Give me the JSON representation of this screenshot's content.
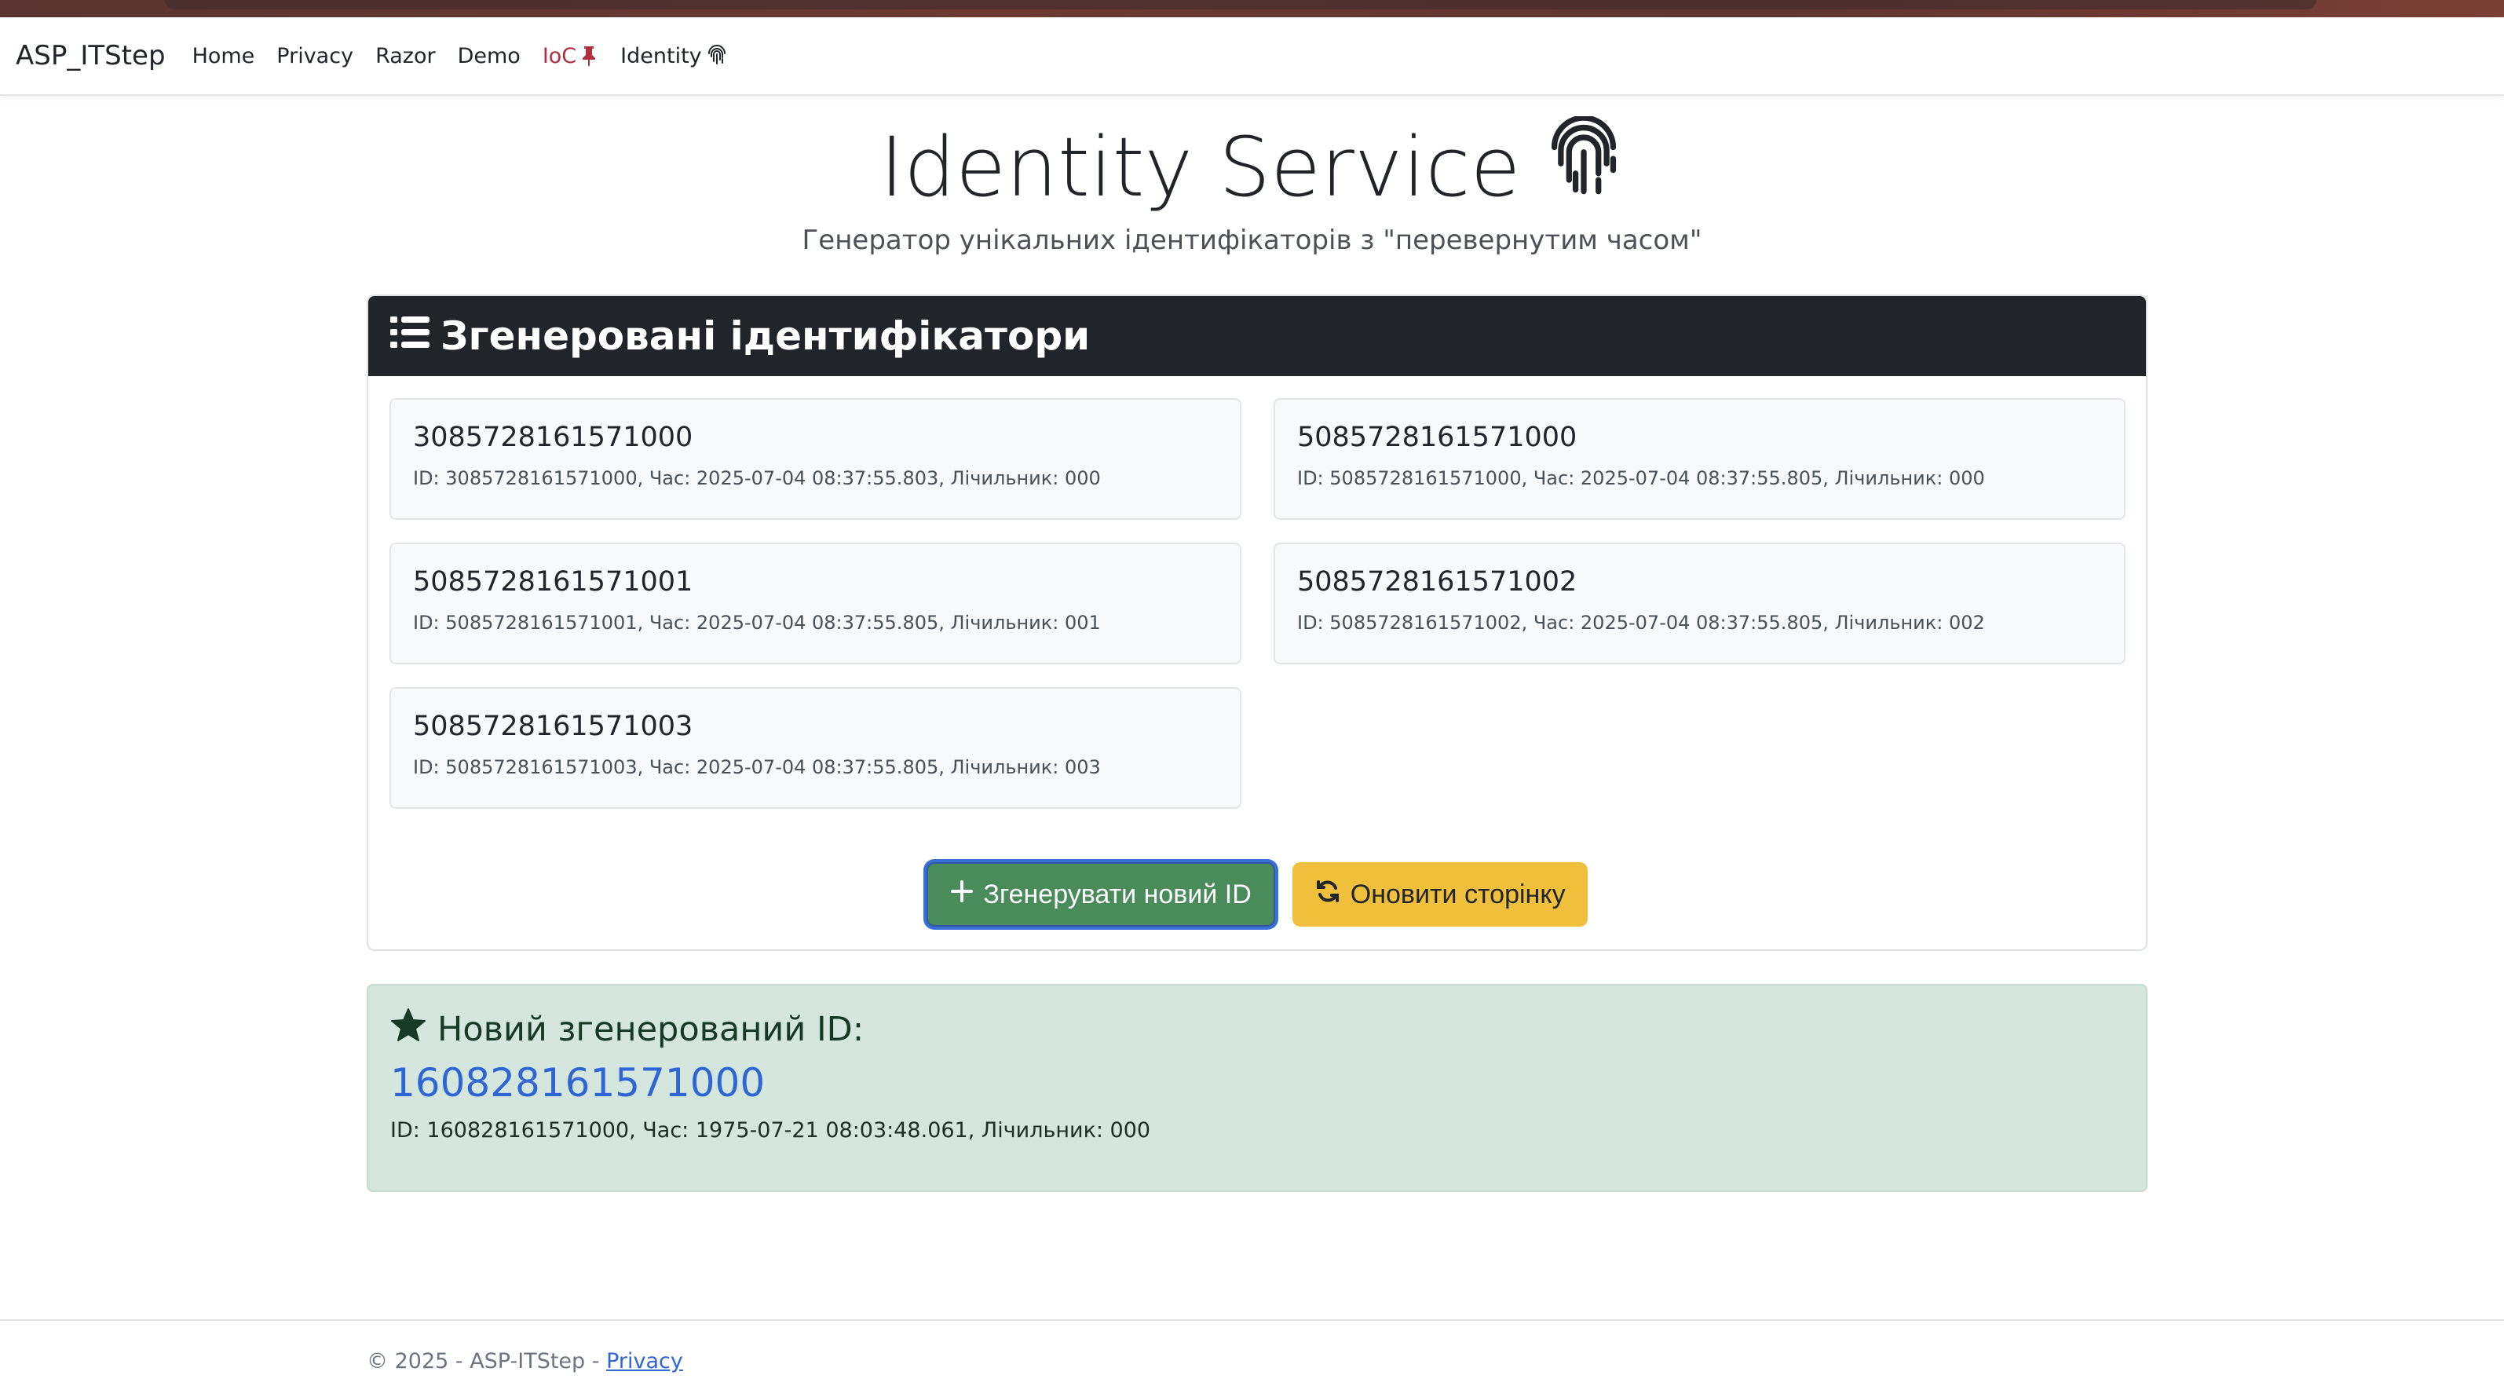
{
  "navbar": {
    "brand": "ASP_ITStep",
    "links": [
      {
        "label": "Home"
      },
      {
        "label": "Privacy"
      },
      {
        "label": "Razor"
      },
      {
        "label": "Demo"
      },
      {
        "label": "IoC",
        "icon": "pin-icon",
        "active": true
      },
      {
        "label": "Identity",
        "icon": "fingerprint-icon"
      }
    ]
  },
  "header": {
    "title": "Identity Service",
    "title_icon": "fingerprint-icon",
    "subtitle": "Генератор унікальних ідентифікаторів з \"перевернутим часом\""
  },
  "card": {
    "title": "Згенеровані ідентифікатори",
    "title_icon": "list-icon",
    "ids": [
      {
        "value": "3085728161571000",
        "meta": "ID: 3085728161571000, Час: 2025-07-04 08:37:55.803, Лічильник: 000"
      },
      {
        "value": "5085728161571000",
        "meta": "ID: 5085728161571000, Час: 2025-07-04 08:37:55.805, Лічильник: 000"
      },
      {
        "value": "5085728161571001",
        "meta": "ID: 5085728161571001, Час: 2025-07-04 08:37:55.805, Лічильник: 001"
      },
      {
        "value": "5085728161571002",
        "meta": "ID: 5085728161571002, Час: 2025-07-04 08:37:55.805, Лічильник: 002"
      },
      {
        "value": "5085728161571003",
        "meta": "ID: 5085728161571003, Час: 2025-07-04 08:37:55.805, Лічильник: 003"
      }
    ],
    "buttons": {
      "generate": {
        "label": "Згенерувати новий ID",
        "icon": "plus-icon"
      },
      "refresh": {
        "label": "Оновити сторінку",
        "icon": "refresh-icon"
      }
    }
  },
  "alert": {
    "title": "Новий згенерований ID:",
    "icon": "star-icon",
    "id_value": "160828161571000",
    "meta": "ID: 160828161571000, Час: 1975-07-21 08:03:48.061, Лічильник: 000"
  },
  "footer": {
    "copyright": "© 2025 - ASP-ITStep - ",
    "privacy_link": "Privacy"
  },
  "colors": {
    "card_header_bg": "#212529",
    "success_button": "#4a8b5c",
    "warning_button": "#f0c03c",
    "alert_bg": "#d4e6dd",
    "link_blue": "#2f66d5",
    "active_nav": "#b0303f"
  }
}
